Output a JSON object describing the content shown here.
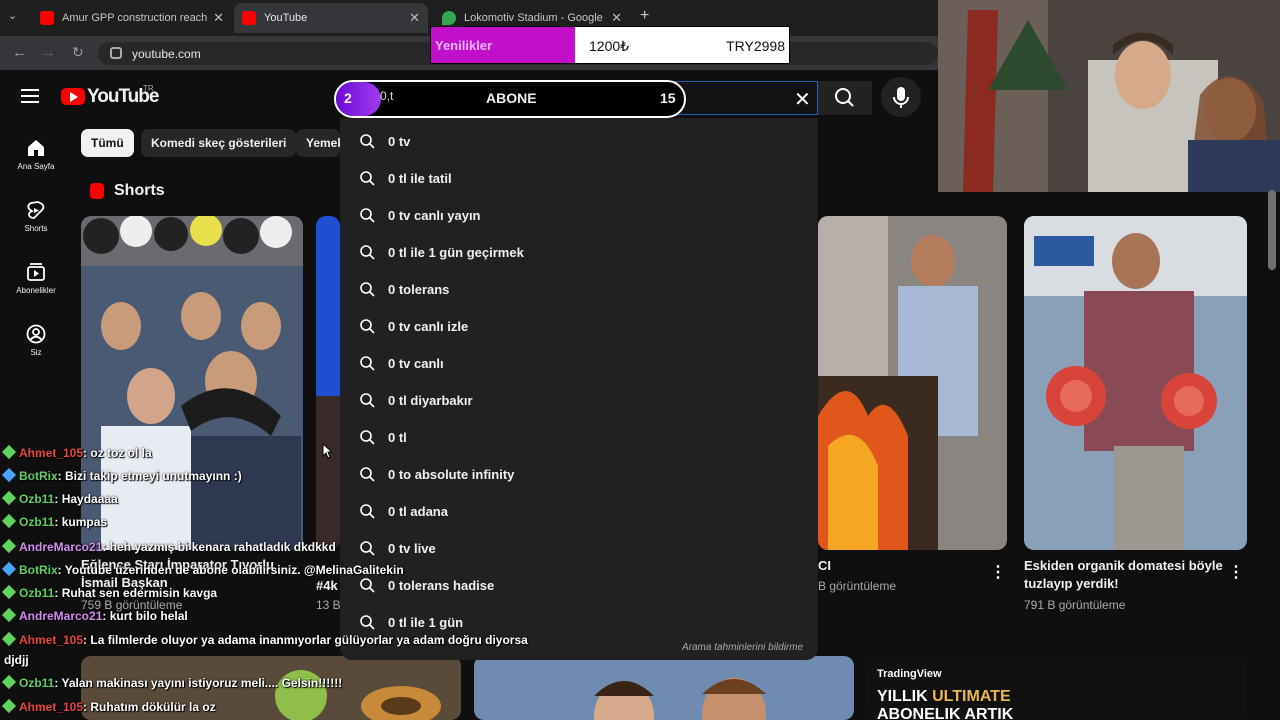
{
  "browser": {
    "tabs": [
      {
        "title": "Amur GPP construction reache",
        "active": false,
        "favicon": "youtube-favicon"
      },
      {
        "title": "YouTube",
        "active": true,
        "favicon": "youtube-favicon"
      },
      {
        "title": "Lokomotiv Stadium - Google H",
        "active": false,
        "favicon": "google-maps-favicon"
      }
    ],
    "url": "youtube.com"
  },
  "donation_overlay": {
    "label": "Yenilikler",
    "amount_try_symbol": "1200₺",
    "amount_try_code": "TRY2998"
  },
  "header": {
    "logo_text": "YouTube",
    "country_code": "TR",
    "search_value": "0,t",
    "search_clear_icon": "close-icon",
    "search_icon": "search-icon",
    "mic_icon": "microphone-icon"
  },
  "goal_overlay": {
    "current": "2",
    "label": "ABONE",
    "target": "15",
    "progress_fraction": 0.13
  },
  "sidebar": {
    "items": [
      {
        "label": "Ana Sayfa",
        "icon": "home-icon"
      },
      {
        "label": "Shorts",
        "icon": "shorts-icon"
      },
      {
        "label": "Abonelikler",
        "icon": "subscriptions-icon"
      },
      {
        "label": "Siz",
        "icon": "user-icon"
      }
    ]
  },
  "chips": [
    "Tümü",
    "Komedi skeç gösterileri",
    "Yemek"
  ],
  "shorts": {
    "section_title": "Shorts",
    "items": [
      {
        "title": "Eğlence Starı İmparator Tıvorlu İsmail Başkan",
        "views": "759 B görüntüleme"
      },
      {
        "title": "#4k",
        "views": "13 B"
      },
      {
        "title": "CI",
        "views": "B görüntüleme"
      },
      {
        "title": "Eskiden organik domatesi böyle tuzlayıp yerdik!",
        "views": "791 B görüntüleme"
      }
    ]
  },
  "suggestions": [
    "0 tv",
    "0 tl ile tatil",
    "0 tv canlı yayın",
    "0 tl ile 1 gün geçirmek",
    "0 tolerans",
    "0 tv canlı izle",
    "0 tv canlı",
    "0 tl diyarbakır",
    "0 tl",
    "0 to absolute infinity",
    "0 tl adana",
    "0 tv live",
    "0 tolerans hadise",
    "0 tl ile 1 gün"
  ],
  "report_predictions": "Arama tahminlerini bildirme",
  "tradingview": {
    "brand": "TradingView",
    "headline_1": "YILLIK",
    "headline_2": "ULTIMATE",
    "headline_3": "ABONELIK ARTIK"
  },
  "chat": [
    {
      "user": "Ahmet_105",
      "text": ": oz toz ol la",
      "color": "#e8453c",
      "badge_color": "#5fd35f"
    },
    {
      "user": "BotRix",
      "text": ": Bizi takip etmeyi unutmayınn :)",
      "color": "#5fd35f",
      "badge_color": "#4aa3ff"
    },
    {
      "user": "Ozb11",
      "text": ": Haydaaaa",
      "color": "#5fd35f",
      "badge_color": "#5fd35f"
    },
    {
      "user": "Ozb11",
      "text": ": kumpas",
      "color": "#5fd35f",
      "badge_color": "#5fd35f"
    },
    {
      "user": "AndreMarco21",
      "text": ": heh yazmış bi kenara rahatladık dkdkkd",
      "color": "#d58cf0",
      "badge_color": "#5fd35f"
    },
    {
      "user": "BotRix",
      "text": ": Youtube üzerinden de abone olabilirsiniz. @MelinaGalitekin",
      "color": "#5fd35f",
      "badge_color": "#4aa3ff"
    },
    {
      "user": "Ozb11",
      "text": ": Ruhat sen edermisin kavga",
      "color": "#5fd35f",
      "badge_color": "#5fd35f"
    },
    {
      "user": "AndreMarco21",
      "text": ": kurt bilo helal",
      "color": "#d58cf0",
      "badge_color": "#5fd35f"
    },
    {
      "user": "Ahmet_105",
      "text": ": La filmlerde oluyor ya adama inanmıyorlar gülüyorlar ya adam doğru diyorsa",
      "color": "#e8453c",
      "badge_color": "#5fd35f"
    },
    {
      "user": "",
      "text": "djdjj",
      "color": "#ffffff",
      "badge_color": ""
    },
    {
      "user": "Ozb11",
      "text": ": Yalan makinası yayını istiyoruz meli.... Gelsin!!!!!!",
      "color": "#5fd35f",
      "badge_color": "#5fd35f"
    },
    {
      "user": "Ahmet_105",
      "text": ": Ruhatım dökülür la oz",
      "color": "#e8453c",
      "badge_color": "#5fd35f"
    }
  ]
}
